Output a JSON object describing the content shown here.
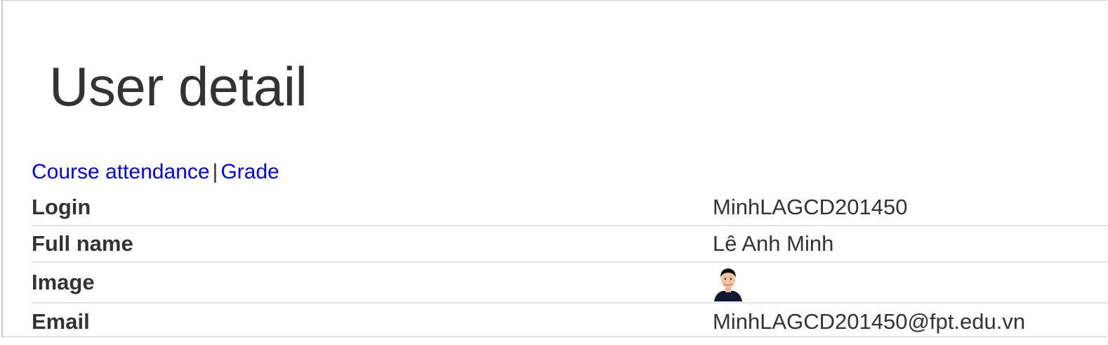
{
  "page": {
    "title": "User detail"
  },
  "nav": {
    "course_attendance": "Course attendance",
    "separator": "|",
    "grade": "Grade"
  },
  "details": {
    "login_label": "Login",
    "login_value": "MinhLAGCD201450",
    "fullname_label": "Full name",
    "fullname_value": "Lê Anh Minh",
    "image_label": "Image",
    "email_label": "Email",
    "email_value": "MinhLAGCD201450@fpt.edu.vn"
  },
  "colors": {
    "link": "#0000ee",
    "text": "#333333",
    "divider": "#e6e6e6"
  }
}
